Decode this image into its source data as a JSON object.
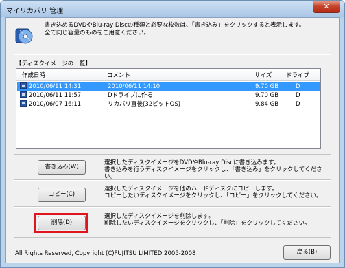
{
  "window": {
    "title": "マイリカバリ 管理",
    "close_label": "✕"
  },
  "intro": {
    "line1": "書き込めるDVDやBlu-ray Discの種類と必要な枚数は、「書き込み」をクリックすると表示します。",
    "line2": "全て同じ容量のものをご用意ください。"
  },
  "list": {
    "title": "【ディスクイメージの一覧】",
    "columns": [
      "作成日時",
      "コメント",
      "サイズ",
      "ドライブ"
    ],
    "rows": [
      {
        "date": "2010/06/11 14:31",
        "comment": "2010/06/11 14:10",
        "size": "9.70 GB",
        "drive": "D",
        "selected": true
      },
      {
        "date": "2010/06/11 11:57",
        "comment": "Dドライブに作る",
        "size": "9.70 GB",
        "drive": "D",
        "selected": false
      },
      {
        "date": "2010/06/07 16:11",
        "comment": "リカバリ直後(32ビットOS)",
        "size": "9.84 GB",
        "drive": "D",
        "selected": false
      }
    ]
  },
  "actions": {
    "write": {
      "label": "書き込み(W)",
      "desc1": "選択したディスクイメージをDVDやBlu-ray Discに書き込みます。",
      "desc2": "書き込みを行うディスクイメージをクリックし、「書き込み」をクリックしてください。"
    },
    "copy": {
      "label": "コピー(C)",
      "desc1": "選択したディスクイメージを他のハードディスクにコピーします。",
      "desc2": "コピーしたいディスクイメージをクリックし、「コピー」をクリックしてください。"
    },
    "delete": {
      "label": "削除(D)",
      "desc1": "選択したディスクイメージを削除します。",
      "desc2": "削除したいディスクイメージをクリックし、「削除」をクリックしてください。"
    }
  },
  "footer": {
    "copyright": "All Rights Reserved, Copyright (C)FUJITSU LIMITED 2005-2008",
    "back_label": "戻る(B)"
  },
  "colors": {
    "selection": "#3399ff",
    "highlight": "#e0141e"
  }
}
